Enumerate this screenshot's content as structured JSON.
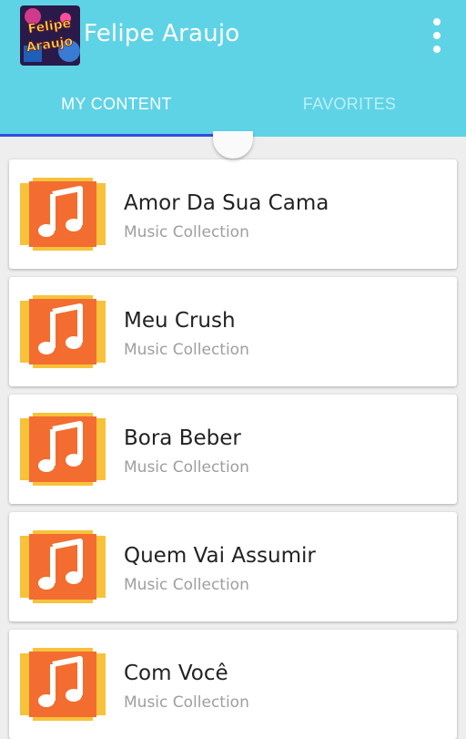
{
  "app": {
    "title": "Felipe Araujo",
    "icon_text_line1": "Felipe",
    "icon_text_line2": "Araujo"
  },
  "tabs": [
    {
      "label": "MY CONTENT",
      "selected": true
    },
    {
      "label": "FAVORITES",
      "selected": false
    }
  ],
  "items": [
    {
      "title": "Amor Da Sua Cama",
      "subtitle": "Music Collection",
      "icon": "music-note-icon"
    },
    {
      "title": "Meu Crush",
      "subtitle": "Music Collection",
      "icon": "music-note-icon"
    },
    {
      "title": "Bora Beber",
      "subtitle": "Music Collection",
      "icon": "music-note-icon"
    },
    {
      "title": "Quem Vai Assumir",
      "subtitle": "Music Collection",
      "icon": "music-note-icon"
    },
    {
      "title": "Com Você",
      "subtitle": "Music Collection",
      "icon": "music-note-icon"
    }
  ],
  "colors": {
    "appbar": "#5fd3e6",
    "tab_indicator": "#2d4fe0",
    "icon_orange": "#f26d2f",
    "icon_yellow": "#f7c23a"
  }
}
